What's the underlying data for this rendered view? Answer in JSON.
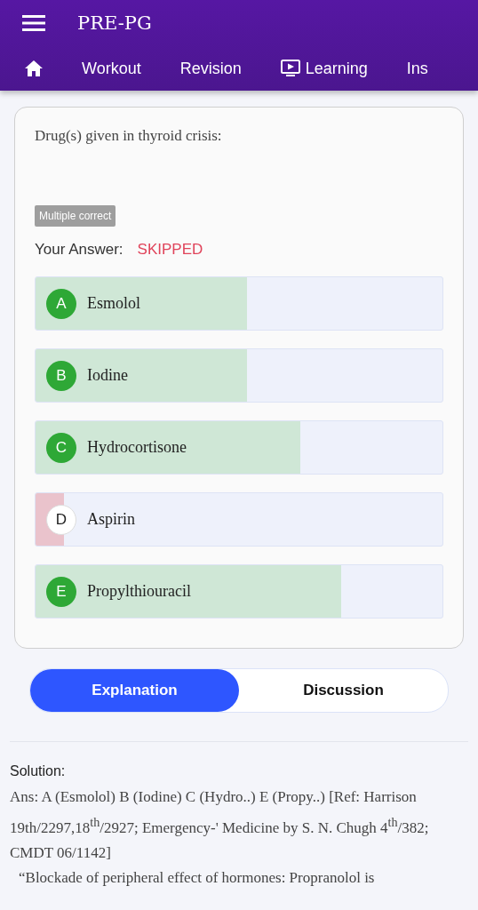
{
  "app_bar": {
    "title": "PRE-PG"
  },
  "nav_tabs": [
    {
      "kind": "home",
      "selected": false
    },
    {
      "kind": "text",
      "label": "Workout",
      "selected": false
    },
    {
      "kind": "text",
      "label": "Revision",
      "selected": false
    },
    {
      "kind": "video",
      "label": "Learning",
      "selected": false
    },
    {
      "kind": "text",
      "label": "Ins",
      "selected": false
    }
  ],
  "question": {
    "text": "Drug(s) given in thyroid crisis:",
    "type_badge": "Multiple correct",
    "answer_label": "Your Answer:",
    "answer_value": "SKIPPED",
    "options": [
      {
        "letter": "A",
        "text": "Esmolol",
        "correct": true,
        "level": 0.52
      },
      {
        "letter": "B",
        "text": "Iodine",
        "correct": true,
        "level": 0.52
      },
      {
        "letter": "C",
        "text": "Hydrocortisone",
        "correct": true,
        "level": 0.65
      },
      {
        "letter": "D",
        "text": "Aspirin",
        "correct": false,
        "level": 0.07
      },
      {
        "letter": "E",
        "text": "Propylthiouracil",
        "correct": true,
        "level": 0.75
      }
    ]
  },
  "segment_tabs": [
    {
      "label": "Explanation",
      "selected": true
    },
    {
      "label": "Discussion",
      "selected": false
    }
  ],
  "solution": {
    "heading": "Solution:",
    "paragraphs": [
      "Ans: A (Esmolol) B (Iodine) C (Hydro..) E (Propy..) [Ref: Harrison 19th/2297,18$^{th}$/2927; Emergency-' Medicine by S. N. Chugh 4$^{th}$/382; CMDT 06/1142]",
      "“Blockade of peripheral effect of hormones: Propranolol is"
    ]
  }
}
